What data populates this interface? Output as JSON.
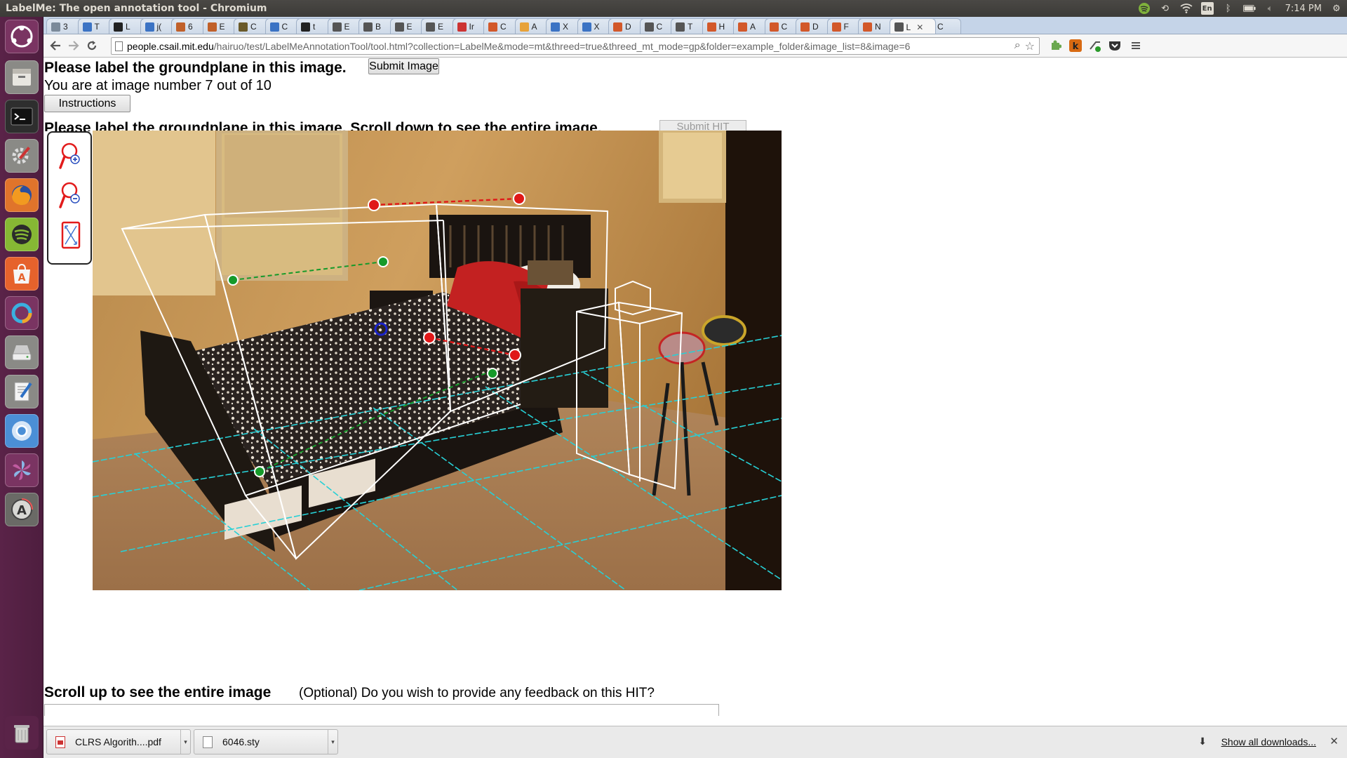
{
  "window": {
    "title": "LabelMe: The open annotation tool - Chromium",
    "clock": "7:14 PM"
  },
  "tray": {
    "input_label": "En",
    "icons": [
      "spotify-tray-icon",
      "sync-icon",
      "wifi-icon",
      "keyboard-icon",
      "bluetooth-icon",
      "battery-icon",
      "volume-icon",
      "settings-gear-icon"
    ]
  },
  "launcher": {
    "items": [
      "ubuntu-dash-icon",
      "files-icon",
      "terminal-icon",
      "system-settings-icon",
      "firefox-icon",
      "spotify-icon",
      "software-center-icon",
      "unity-tweak-icon",
      "disk-icon",
      "text-editor-icon",
      "chromium-icon",
      "shotwell-icon",
      "software-updater-icon",
      "trash-icon"
    ]
  },
  "tabs": [
    {
      "label": "3",
      "fav": "#7b8a9a"
    },
    {
      "label": "T",
      "fav": "#3b73c4"
    },
    {
      "label": "L",
      "fav": "#222"
    },
    {
      "label": "j(",
      "fav": "#3b73c4"
    },
    {
      "label": "6",
      "fav": "#c0602a"
    },
    {
      "label": "E",
      "fav": "#c0602a"
    },
    {
      "label": "C",
      "fav": "#6a5a2a"
    },
    {
      "label": "C",
      "fav": "#3b73c4"
    },
    {
      "label": "t",
      "fav": "#222"
    },
    {
      "label": "E",
      "fav": "#555"
    },
    {
      "label": "B",
      "fav": "#555"
    },
    {
      "label": "E",
      "fav": "#555"
    },
    {
      "label": "E",
      "fav": "#555"
    },
    {
      "label": "Ir",
      "fav": "#c33"
    },
    {
      "label": "C",
      "fav": "#d2582a"
    },
    {
      "label": "A",
      "fav": "#e7a23a"
    },
    {
      "label": "X",
      "fav": "#3b73c4"
    },
    {
      "label": "X",
      "fav": "#3b73c4"
    },
    {
      "label": "D",
      "fav": "#d2582a"
    },
    {
      "label": "C",
      "fav": "#555"
    },
    {
      "label": "T",
      "fav": "#555"
    },
    {
      "label": "H",
      "fav": "#d2582a"
    },
    {
      "label": "A",
      "fav": "#d2582a"
    },
    {
      "label": "C",
      "fav": "#d2582a"
    },
    {
      "label": "D",
      "fav": "#d2582a"
    },
    {
      "label": "F",
      "fav": "#d2582a"
    },
    {
      "label": "N",
      "fav": "#d2582a"
    },
    {
      "label": "L",
      "fav": "#555",
      "active": true
    },
    {
      "label": "C",
      "fav": "#8aa"
    }
  ],
  "url": {
    "host": "people.csail.mit.edu",
    "path": "/hairuo/test/LabelMeAnnotationTool/tool.html?collection=LabelMe&mode=mt&threed=true&threed_mt_mode=gp&folder=example_folder&image_list=8&image=6"
  },
  "page": {
    "heading": "Please label the groundplane in this image.",
    "submit_image": "Submit Image",
    "counter": "You are at image number 7 out of 10",
    "instructions": "Instructions",
    "obscured_heading": "Please label the groundplane in this image. Scroll down to see the entire image.",
    "submit_hit": "Submit HIT",
    "footer_heading": "Scroll up to see the entire image",
    "feedback_question": "(Optional) Do you wish to provide any feedback on this HIT?",
    "feedback_value": ""
  },
  "zoom_tools": [
    "zoom-in-icon",
    "zoom-out-icon",
    "fit-to-screen-icon"
  ],
  "downloads": {
    "items": [
      {
        "name": "CLRS Algorith....pdf",
        "icon": "pdf-file-icon"
      },
      {
        "name": "6046.sty",
        "icon": "text-file-icon"
      }
    ],
    "show_all": "Show all downloads..."
  }
}
